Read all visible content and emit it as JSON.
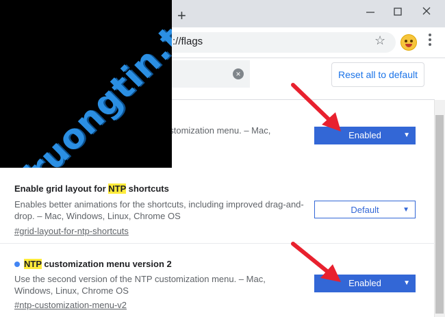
{
  "browser": {
    "new_tab_label": "+",
    "url": "://flags",
    "icons": [
      "plus-icon",
      "minimize-icon",
      "maximize-icon",
      "close-icon",
      "star-icon",
      "avatar-icon",
      "menu-icon"
    ]
  },
  "flags_page": {
    "reset_button": "Reset all to default",
    "search_clear_icon": "×"
  },
  "flags": [
    {
      "description": "ustomization menu. – Mac,",
      "state": "Enabled"
    },
    {
      "title_pre": "Enable grid layout for ",
      "title_hl": "NTP",
      "title_post": " shortcuts",
      "description": "Enables better animations for the shortcuts, including improved drag-and-drop. – Mac, Windows, Linux, Chrome OS",
      "link": "#grid-layout-for-ntp-shortcuts",
      "state": "Default"
    },
    {
      "title_hl": "NTP",
      "title_post": " customization menu version 2",
      "description": "Use the second version of the NTP customization menu. – Mac, Windows, Linux, Chrome OS",
      "link": "#ntp-customization-menu-v2",
      "state": "Enabled",
      "modified": true
    }
  ],
  "watermark": {
    "text": "Truongtin.top"
  },
  "colors": {
    "accent": "#3367d6",
    "highlight": "#ffeb3b",
    "arrow": "#e8212e",
    "watermark": "#2b8fe3"
  }
}
